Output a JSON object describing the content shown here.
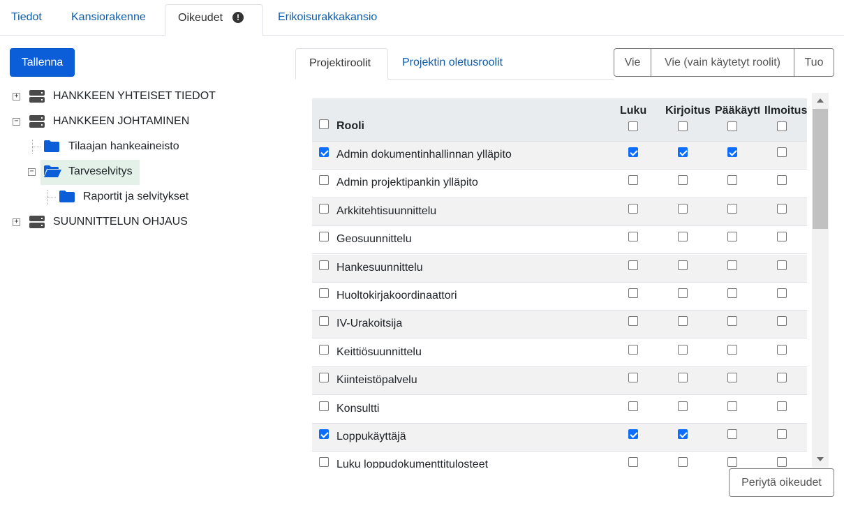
{
  "top_tabs": [
    {
      "label": "Tiedot",
      "active": false
    },
    {
      "label": "Kansiorakenne",
      "active": false
    },
    {
      "label": "Oikeudet",
      "active": true,
      "alert": "!"
    },
    {
      "label": "Erikoisurakkakansio",
      "active": false
    }
  ],
  "save_label": "Tallenna",
  "tree": [
    {
      "label": "HANKKEEN YHTEISET TIEDOT",
      "icon": "database-icon",
      "expander": "+"
    },
    {
      "label": "HANKKEEN JOHTAMINEN",
      "icon": "database-icon",
      "expander": "−"
    },
    {
      "label": "Tilaajan hankeaineisto",
      "icon": "folder-icon"
    },
    {
      "label": "Tarveselvitys",
      "icon": "folder-open-icon",
      "expander": "−",
      "selected": true
    },
    {
      "label": "Raportit ja selvitykset",
      "icon": "folder-icon"
    },
    {
      "label": "SUUNNITTELUN OHJAUS",
      "icon": "database-icon",
      "expander": "+"
    }
  ],
  "sub_tabs": [
    {
      "label": "Projektiroolit",
      "active": true
    },
    {
      "label": "Projektin oletusroolit",
      "active": false
    }
  ],
  "actions": {
    "vie": "Vie",
    "vie_used": "Vie (vain käytetyt roolit)",
    "tuo": "Tuo",
    "inherit": "Periytä oikeudet"
  },
  "table": {
    "role_header": "Rooli",
    "columns": [
      "Luku",
      "Kirjoitus",
      "Pääkäyttäjä",
      "Ilmoitus"
    ],
    "header_checks": [
      false,
      false,
      false,
      false
    ],
    "rows": [
      {
        "label": "Admin dokumentinhallinnan ylläpito",
        "checked": true,
        "perms": [
          true,
          true,
          true,
          false
        ]
      },
      {
        "label": "Admin projektipankin ylläpito",
        "checked": false,
        "perms": [
          false,
          false,
          false,
          false
        ]
      },
      {
        "label": "Arkkitehtisuunnittelu",
        "checked": false,
        "perms": [
          false,
          false,
          false,
          false
        ]
      },
      {
        "label": "Geosuunnittelu",
        "checked": false,
        "perms": [
          false,
          false,
          false,
          false
        ]
      },
      {
        "label": "Hankesuunnittelu",
        "checked": false,
        "perms": [
          false,
          false,
          false,
          false
        ]
      },
      {
        "label": "Huoltokirjakoordinaattori",
        "checked": false,
        "perms": [
          false,
          false,
          false,
          false
        ]
      },
      {
        "label": "IV-Urakoitsija",
        "checked": false,
        "perms": [
          false,
          false,
          false,
          false
        ]
      },
      {
        "label": "Keittiösuunnittelu",
        "checked": false,
        "perms": [
          false,
          false,
          false,
          false
        ]
      },
      {
        "label": "Kiinteistöpalvelu",
        "checked": false,
        "perms": [
          false,
          false,
          false,
          false
        ]
      },
      {
        "label": "Konsultti",
        "checked": false,
        "perms": [
          false,
          false,
          false,
          false
        ]
      },
      {
        "label": "Loppukäyttäjä",
        "checked": true,
        "perms": [
          true,
          true,
          false,
          false
        ]
      },
      {
        "label": "Luku loppudokumenttitulosteet",
        "checked": false,
        "perms": [
          false,
          false,
          false,
          false
        ]
      }
    ]
  }
}
